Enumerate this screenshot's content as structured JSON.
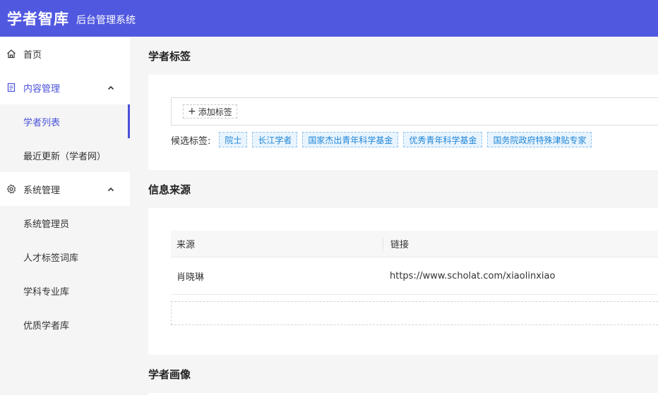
{
  "header": {
    "brand": "学者智库",
    "subtitle": "后台管理系统"
  },
  "sidebar": {
    "home": "首页",
    "content_mgmt": "内容管理",
    "scholar_list": "学者列表",
    "recent_updates": "最近更新（学者网）",
    "system_mgmt": "系统管理",
    "sys_admin": "系统管理员",
    "talent_tags": "人才标签词库",
    "disciplines": "学科专业库",
    "quality_scholars": "优质学者库"
  },
  "tags_section": {
    "title": "学者标签",
    "add_label": "添加标签",
    "candidates_label": "候选标签:",
    "candidates": [
      "院士",
      "长江学者",
      "国家杰出青年科学基金",
      "优秀青年科学基金",
      "国务院政府特殊津贴专家"
    ]
  },
  "source_section": {
    "title": "信息来源",
    "columns": [
      "来源",
      "链接"
    ],
    "rows": [
      {
        "source": "肖晓琳",
        "link": "https://www.scholat.com/xiaolinxiao"
      }
    ]
  },
  "portrait_section": {
    "title": "学者画像"
  },
  "colors": {
    "header_bg": "#5158e0",
    "accent": "#4a52d9",
    "tag_blue": "#1f86d8"
  }
}
